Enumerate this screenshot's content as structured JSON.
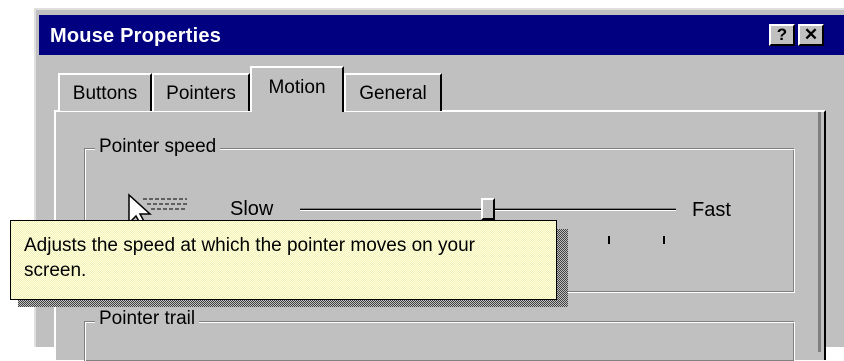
{
  "window": {
    "title": "Mouse Properties",
    "help_button": "?",
    "close_button": "✕"
  },
  "tabs": [
    {
      "label": "Buttons",
      "selected": false
    },
    {
      "label": "Pointers",
      "selected": false
    },
    {
      "label": "Motion",
      "selected": true
    },
    {
      "label": "General",
      "selected": false
    }
  ],
  "pointer_speed": {
    "group_label": "Pointer speed",
    "slow_label": "Slow",
    "fast_label": "Fast",
    "value": 0.5,
    "tick_positions": [
      0.82,
      0.965
    ]
  },
  "pointer_trail": {
    "group_label": "Pointer trail"
  },
  "tooltip": {
    "text": "Adjusts the speed at which the pointer moves on your screen."
  },
  "colors": {
    "titlebar": "#000080",
    "face": "#c0c0c0",
    "tooltip_bg": "#ffffe1"
  }
}
